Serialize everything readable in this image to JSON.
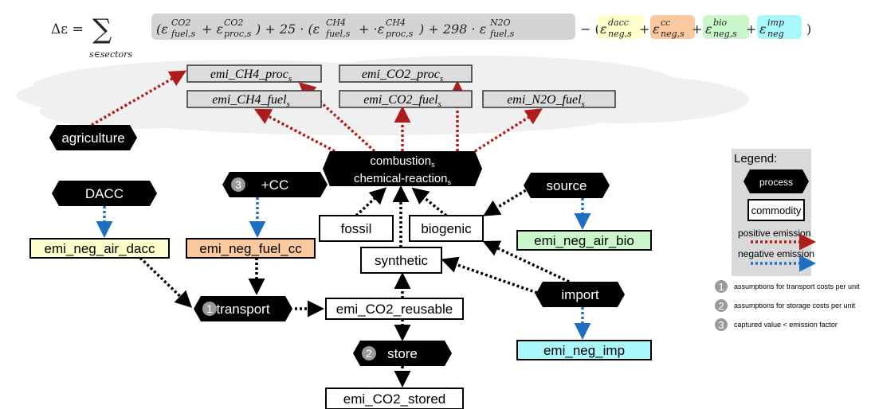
{
  "colors": {
    "positive": "#b01c1c",
    "negative": "#1f6ec2",
    "neutral": "#000000",
    "cloud": "#f0f0f0",
    "emi_box": "#dcdcdc",
    "formula_gray": "#d4d4d4",
    "dacc": "#ffffcc",
    "cc": "#fbc9a0",
    "bio": "#c9f7c9",
    "imp": "#a9f7fb",
    "legend_bg": "#d9d9d9",
    "badge": "#9a9a9a"
  },
  "formula": {
    "lhs": "Δε =",
    "sum": "∑",
    "sum_sub": "s∈sectors",
    "gray_part": "(ε^CO2_fuel,s + ε^CO2_proc,s) + 25 · (ε^CH4_fuel,s + ·ε^CH4_proc,s) + 298 · ε^N2O_fuel,s",
    "minus": "− (",
    "close": ")",
    "terms": [
      {
        "sup": "dacc",
        "sub": "neg,s",
        "color_key": "dacc"
      },
      {
        "sup": "cc",
        "sub": "neg,s",
        "color_key": "cc"
      },
      {
        "sup": "bio",
        "sub": "neg,s",
        "color_key": "bio"
      },
      {
        "sup": "imp",
        "sub": "neg",
        "color_key": "imp"
      }
    ]
  },
  "emissions": [
    {
      "id": "emi_ch4_proc",
      "label": "emi_CH4_proc",
      "sub": "s"
    },
    {
      "id": "emi_co2_proc",
      "label": "emi_CO2_proc",
      "sub": "s"
    },
    {
      "id": "emi_ch4_fuel",
      "label": "emi_CH4_fuel",
      "sub": "s"
    },
    {
      "id": "emi_co2_fuel",
      "label": "emi_CO2_fuel",
      "sub": "s"
    },
    {
      "id": "emi_n2o_fuel",
      "label": "emi_N2O_fuel",
      "sub": "s"
    }
  ],
  "processes": {
    "agriculture": {
      "label": "agriculture"
    },
    "combustion": {
      "line1": "combustion",
      "line2": "chemical-reaction",
      "sub": "s"
    },
    "dacc": {
      "label": "DACC"
    },
    "cc": {
      "label": "+CC",
      "badge": "3"
    },
    "source": {
      "label": "source"
    },
    "import": {
      "label": "import"
    },
    "transport": {
      "label": "transport",
      "badge": "1"
    },
    "store": {
      "label": "store",
      "badge": "2"
    }
  },
  "commodities": {
    "fossil": "fossil",
    "biogenic": "biogenic",
    "synthetic": "synthetic",
    "emi_co2_reusable": "emi_CO2_reusable",
    "emi_co2_stored": "emi_CO2_stored",
    "emi_neg_air_dacc": "emi_neg_air_dacc",
    "emi_neg_fuel_cc": "emi_neg_fuel_cc",
    "emi_neg_air_bio": "emi_neg_air_bio",
    "emi_neg_imp": "emi_neg_imp"
  },
  "legend": {
    "title": "Legend:",
    "process": "process",
    "commodity": "commodity",
    "positive": "positive emission",
    "negative": "negative emission"
  },
  "notes": [
    {
      "badge": "1",
      "text": "assumptions for transport costs per unit"
    },
    {
      "badge": "2",
      "text": "assumptions for storage costs per unit"
    },
    {
      "badge": "3",
      "text": "captured value < emission factor"
    }
  ]
}
